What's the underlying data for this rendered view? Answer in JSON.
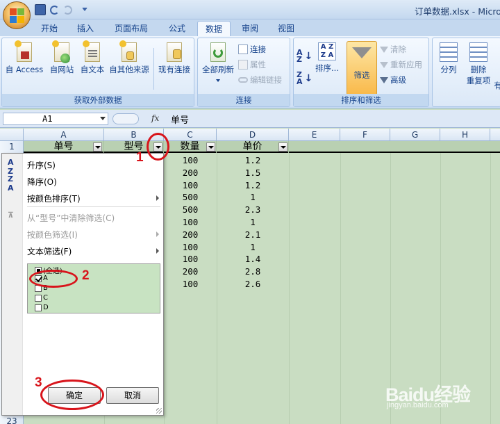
{
  "window": {
    "title": "订单数据.xlsx - Micros"
  },
  "tabs": [
    {
      "label": "开始",
      "active": false
    },
    {
      "label": "插入",
      "active": false
    },
    {
      "label": "页面布局",
      "active": false
    },
    {
      "label": "公式",
      "active": false
    },
    {
      "label": "数据",
      "active": true
    },
    {
      "label": "审阅",
      "active": false
    },
    {
      "label": "视图",
      "active": false
    }
  ],
  "ribbon": {
    "external": {
      "label": "获取外部数据",
      "buttons": [
        "自 Access",
        "自网站",
        "自文本",
        "自其他来源",
        "现有连接"
      ]
    },
    "connections": {
      "label": "连接",
      "refresh_all": "全部刷新",
      "connect": "连接",
      "properties": "属性",
      "edit_links": "编辑链接"
    },
    "sort_filter": {
      "label": "排序和筛选",
      "sort": "排序...",
      "filter": "筛选",
      "clear": "清除",
      "reapply": "重新应用",
      "advanced": "高级"
    },
    "tools": {
      "split": "分列",
      "remove_dup_1": "删除",
      "remove_dup_2": "重复项",
      "extra": "有"
    }
  },
  "formula_bar": {
    "name_box": "A1",
    "fx": "fx",
    "content": "单号"
  },
  "columns": [
    "A",
    "B",
    "C",
    "D",
    "E",
    "F",
    "G",
    "H"
  ],
  "rows": {
    "first": "1",
    "last_visible": "23"
  },
  "headers": {
    "A": "单号",
    "B": "型号",
    "C": "数量",
    "D": "单价"
  },
  "table": {
    "quantity": [
      "100",
      "200",
      "100",
      "500",
      "500",
      "100",
      "200",
      "100",
      "100",
      "200",
      "100"
    ],
    "price": [
      "1.2",
      "1.5",
      "1.2",
      "1",
      "2.3",
      "1",
      "2.1",
      "1",
      "1.4",
      "2.8",
      "2.6"
    ]
  },
  "filter_menu": {
    "sort_asc": "升序(S)",
    "sort_desc": "降序(O)",
    "sort_by_color": "按颜色排序(T)",
    "clear_filter": "从“型号”中清除筛选(C)",
    "filter_by_color": "按颜色筛选(I)",
    "text_filter": "文本筛选(F)",
    "items": [
      {
        "label": "(全选)",
        "state": "partial"
      },
      {
        "label": "A",
        "state": "checked"
      },
      {
        "label": "B",
        "state": "unchecked"
      },
      {
        "label": "C",
        "state": "unchecked"
      },
      {
        "label": "D",
        "state": "unchecked"
      }
    ],
    "ok": "确定",
    "cancel": "取消"
  },
  "annotations": [
    "1",
    "2",
    "3"
  ],
  "watermark": {
    "brand": "Baidu经验",
    "url": "jingyan.baidu.com"
  },
  "colors": {
    "ribbon": "#dde9f8",
    "sheet_fill": "#c9ddc2",
    "annotation": "#d8141b",
    "filter_orange": "#f9b94a"
  }
}
